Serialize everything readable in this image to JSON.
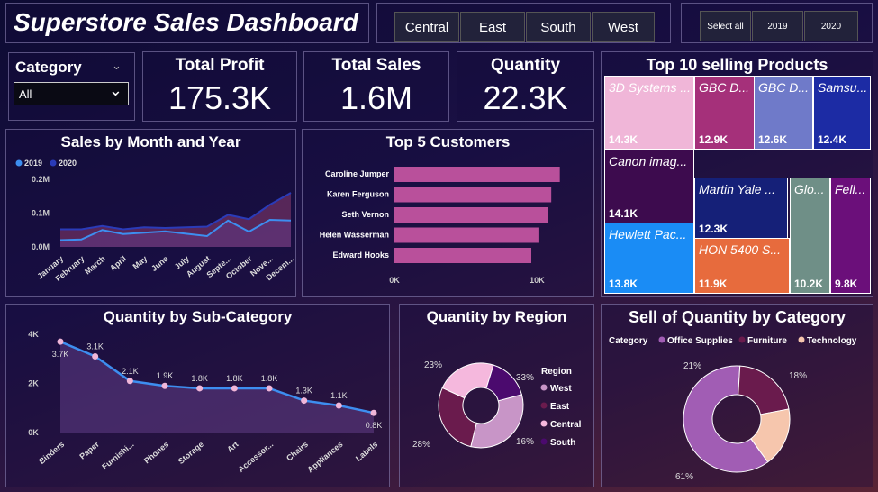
{
  "header": {
    "title": "Superstore Sales Dashboard"
  },
  "regions": [
    "Central",
    "East",
    "South",
    "West"
  ],
  "years": {
    "select_all": "Select all",
    "y2019": "2019",
    "y2020": "2020"
  },
  "category_filter": {
    "label": "Category",
    "value": "All"
  },
  "kpis": {
    "profit": {
      "label": "Total Profit",
      "value": "175.3K"
    },
    "sales": {
      "label": "Total Sales",
      "value": "1.6M"
    },
    "quantity": {
      "label": "Quantity",
      "value": "22.3K"
    }
  },
  "colors": {
    "accent": "#3d8ef0",
    "pink": "#b9509b",
    "lightpink": "#f0b6d8"
  },
  "chart_data": [
    {
      "type": "area",
      "id": "sales_month",
      "title": "Sales by Month and Year",
      "categories": [
        "January",
        "February",
        "March",
        "April",
        "May",
        "June",
        "July",
        "August",
        "September",
        "October",
        "November",
        "December"
      ],
      "tick_labels": [
        "January",
        "February",
        "March",
        "April",
        "May",
        "June",
        "July",
        "August",
        "Septe...",
        "October",
        "Nove...",
        "Decem..."
      ],
      "ylim": [
        0,
        200000
      ],
      "yticks": [
        "0.0M",
        "0.1M",
        "0.2M"
      ],
      "series": [
        {
          "name": "2019",
          "values": [
            20000,
            22000,
            50000,
            38000,
            42000,
            46000,
            39000,
            32000,
            78000,
            45000,
            80000,
            78000
          ],
          "color": "#3d8ef0"
        },
        {
          "name": "2020",
          "values": [
            52000,
            52000,
            62000,
            52000,
            58000,
            56000,
            58000,
            60000,
            95000,
            82000,
            125000,
            160000
          ],
          "color": "#2a3bb8"
        }
      ]
    },
    {
      "type": "bar",
      "id": "top_customers",
      "title": "Top 5 Customers",
      "categories": [
        "Caroline Jumper",
        "Karen Ferguson",
        "Seth Vernon",
        "Helen Wasserman",
        "Edward Hooks"
      ],
      "values": [
        11600,
        11000,
        10800,
        10100,
        9600
      ],
      "xlim": [
        0,
        12000
      ],
      "xticks": [
        "0K",
        "10K"
      ]
    },
    {
      "type": "treemap",
      "id": "top_products",
      "title": "Top 10 selling Products",
      "items": [
        {
          "name": "3D Systems ...",
          "value": "14.3K",
          "color": "#f0b6d8"
        },
        {
          "name": "GBC D...",
          "value": "12.9K",
          "color": "#a5307a"
        },
        {
          "name": "GBC D...",
          "value": "12.6K",
          "color": "#6f7ac9"
        },
        {
          "name": "Samsu...",
          "value": "12.4K",
          "color": "#1c2ba4"
        },
        {
          "name": "Canon imag...",
          "value": "14.1K",
          "color": "#3d0b4e"
        },
        {
          "name": "Martin Yale ...",
          "value": "12.3K",
          "color": "#152078"
        },
        {
          "name": "Glo...",
          "value": "10.2K",
          "color": "#6f8f87"
        },
        {
          "name": "Fell...",
          "value": "9.8K",
          "color": "#6b0f7a"
        },
        {
          "name": "Hewlett Pac...",
          "value": "13.8K",
          "color": "#1a8cf5"
        },
        {
          "name": "HON 5400 S...",
          "value": "11.9K",
          "color": "#e76b3d"
        }
      ]
    },
    {
      "type": "line",
      "id": "qty_subcat",
      "title": "Quantity by Sub-Category",
      "categories": [
        "Binders",
        "Paper",
        "Furnishi...",
        "Phones",
        "Storage",
        "Art",
        "Accessor...",
        "Chairs",
        "Appliances",
        "Labels"
      ],
      "values": [
        3700,
        3100,
        2100,
        1900,
        1800,
        1800,
        1800,
        1300,
        1100,
        800
      ],
      "labels": [
        "3.7K",
        "3.1K",
        "2.1K",
        "1.9K",
        "1.8K",
        "1.8K",
        "1.8K",
        "1.3K",
        "1.1K",
        "0.8K"
      ],
      "ylim": [
        0,
        4000
      ],
      "yticks": [
        "0K",
        "2K",
        "4K"
      ]
    },
    {
      "type": "pie",
      "id": "qty_region",
      "title": "Quantity by Region",
      "legend_title": "Region",
      "slices": [
        {
          "name": "West",
          "value": 33,
          "label": "33%",
          "color": "#c895c7"
        },
        {
          "name": "East",
          "value": 28,
          "label": "28%",
          "color": "#6a1b4d"
        },
        {
          "name": "Central",
          "value": 23,
          "label": "23%",
          "color": "#f5b8dd"
        },
        {
          "name": "South",
          "value": 16,
          "label": "16%",
          "color": "#4b0a6e"
        }
      ]
    },
    {
      "type": "pie",
      "id": "qty_category",
      "title": "Sell of Quantity by Category",
      "legend_title": "Category",
      "slices": [
        {
          "name": "Office Supplies",
          "value": 61,
          "label": "61%",
          "color": "#a15db4"
        },
        {
          "name": "Furniture",
          "value": 21,
          "label": "21%",
          "color": "#6a1b4d"
        },
        {
          "name": "Technology",
          "value": 18,
          "label": "18%",
          "color": "#f6c6ad"
        }
      ]
    }
  ]
}
